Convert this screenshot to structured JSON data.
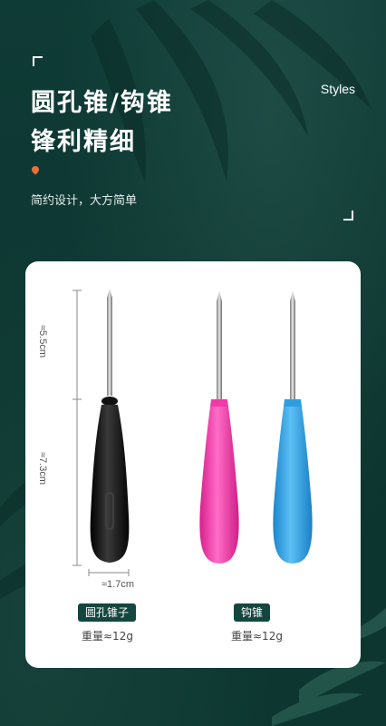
{
  "header": {
    "title_line1": "圆孔锥/钩锥",
    "title_line2": "锋利精细",
    "styles_label": "Styles",
    "subtitle": "简约设计，大方简单"
  },
  "dimensions": {
    "needle_length": "≈5.5cm",
    "handle_length": "≈7.3cm",
    "handle_width": "≈1.7cm"
  },
  "products": [
    {
      "name": "圆孔锥子",
      "weight": "重量≈12g",
      "color": "#111111"
    },
    {
      "name": "钩锥",
      "weight": "重量≈12g",
      "colors": [
        "#f03aa8",
        "#2e9ee0"
      ]
    }
  ],
  "colors": {
    "background": "#0f3a35",
    "tag_bg": "#14463f",
    "accent_dot": "#e9723c",
    "handle_black": "#111111",
    "handle_pink": "#f03aa8",
    "handle_blue": "#2e9ee0"
  }
}
